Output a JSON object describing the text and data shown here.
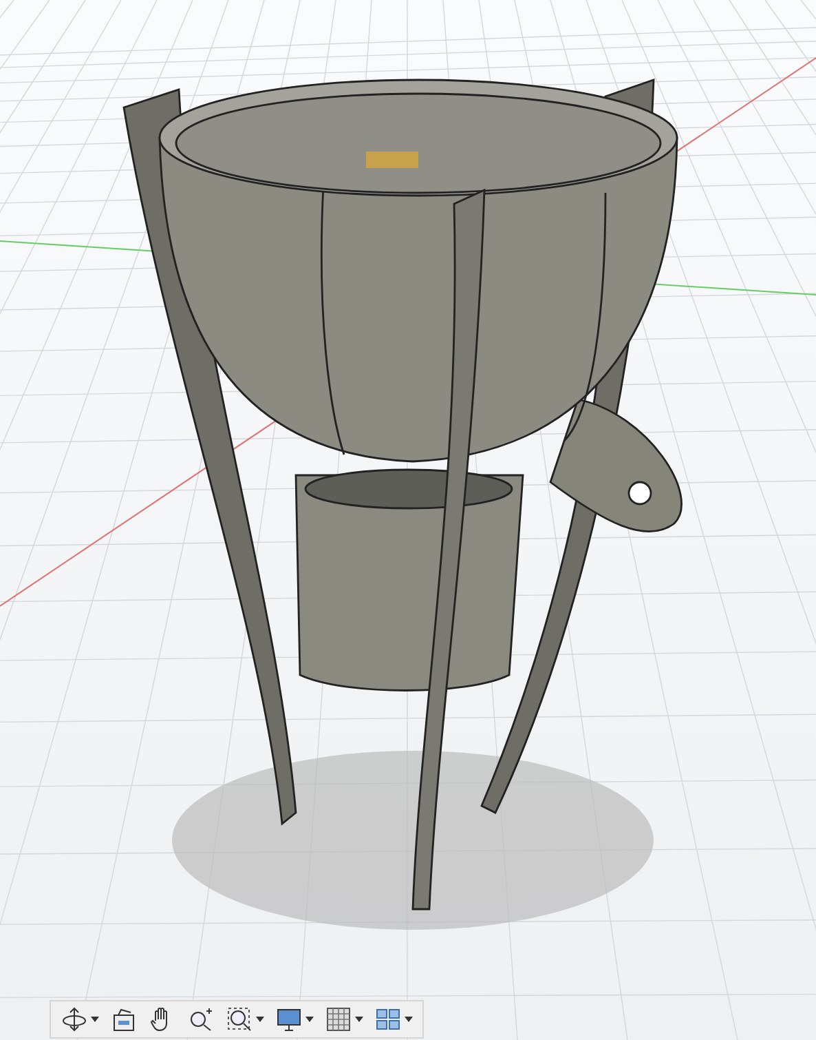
{
  "viewport": {
    "toolbar": [
      {
        "kind": "orbit",
        "dropdown": true
      },
      {
        "kind": "look",
        "dropdown": false
      },
      {
        "kind": "pan",
        "dropdown": false
      },
      {
        "kind": "zoom",
        "dropdown": false
      },
      {
        "kind": "fit",
        "dropdown": true
      },
      {
        "kind": "display",
        "dropdown": true
      },
      {
        "kind": "grid",
        "dropdown": true
      },
      {
        "kind": "viewports",
        "dropdown": true
      }
    ]
  }
}
